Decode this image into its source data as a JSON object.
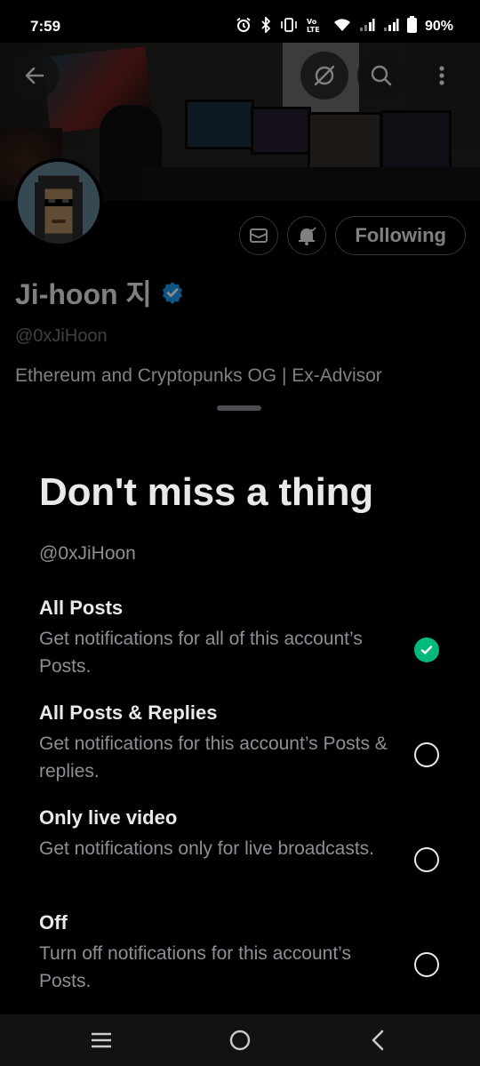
{
  "status_bar": {
    "time": "7:59",
    "battery": "90%",
    "icons": [
      "alarm-icon",
      "bluetooth-icon",
      "vibrate-icon",
      "volte-icon",
      "wifi-icon",
      "signal-icon",
      "signal-icon",
      "battery-icon"
    ]
  },
  "header": {
    "icons": [
      "back-arrow-icon",
      "grok-icon",
      "search-icon",
      "more-vertical-icon"
    ]
  },
  "profile": {
    "display_name": "Ji-hoon 지",
    "handle": "@0xJiHoon",
    "bio": "Ethereum and Cryptopunks OG |  Ex-Advisor",
    "verified": true,
    "following_label": "Following",
    "action_icons": [
      "mail-icon",
      "notification-bell-icon"
    ]
  },
  "sheet": {
    "title": "Don't miss a thing",
    "handle": "@0xJiHoon",
    "options": [
      {
        "title": "All Posts",
        "desc": "Get notifications for all of this account’s Posts.",
        "checked": true
      },
      {
        "title": "All Posts & Replies",
        "desc": "Get notifications for this account’s Posts & replies.",
        "checked": false
      },
      {
        "title": "Only live video",
        "desc": "Get notifications only for live broadcasts.",
        "checked": false
      },
      {
        "title": "Off",
        "desc": "Turn off notifications for this account’s Posts.",
        "checked": false
      }
    ]
  },
  "navbar": {
    "icons": [
      "recents-icon",
      "home-icon",
      "back-icon"
    ]
  },
  "colors": {
    "background": "#000000",
    "text_primary": "#e7e9ea",
    "text_secondary": "#8b9096",
    "check_green": "#00ba7c",
    "verified_blue": "#1d9bf0"
  }
}
